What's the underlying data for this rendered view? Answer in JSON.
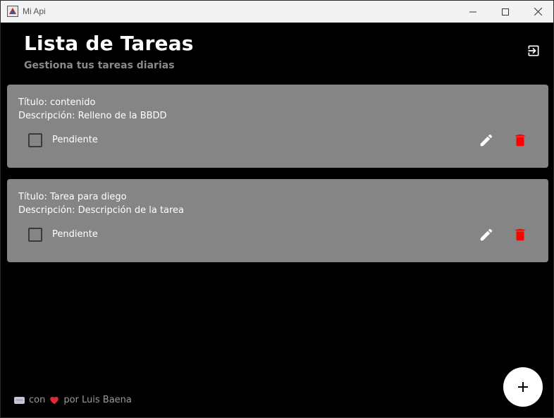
{
  "window": {
    "title": "Mi Api"
  },
  "header": {
    "title": "Lista de Tareas",
    "subtitle": "Gestiona tus tareas diarias",
    "logout_icon": "logout-icon"
  },
  "tasks": [
    {
      "title_label": "Título:",
      "title": "contenido",
      "description_label": "Descripción:",
      "description": "Relleno de la BBDD",
      "status": "Pendiente",
      "completed": false
    },
    {
      "title_label": "Título:",
      "title": "Tarea para diego",
      "description_label": "Descripción:",
      "description": "Descripción de la tarea",
      "status": "Pendiente",
      "completed": false
    }
  ],
  "footer": {
    "con": "con",
    "por": "por Luis Baena"
  },
  "colors": {
    "card_bg": "#858585",
    "delete": "#ff0000",
    "subtitle": "#8a8a8a",
    "background": "#000000"
  },
  "fab": {
    "icon": "plus-icon"
  }
}
